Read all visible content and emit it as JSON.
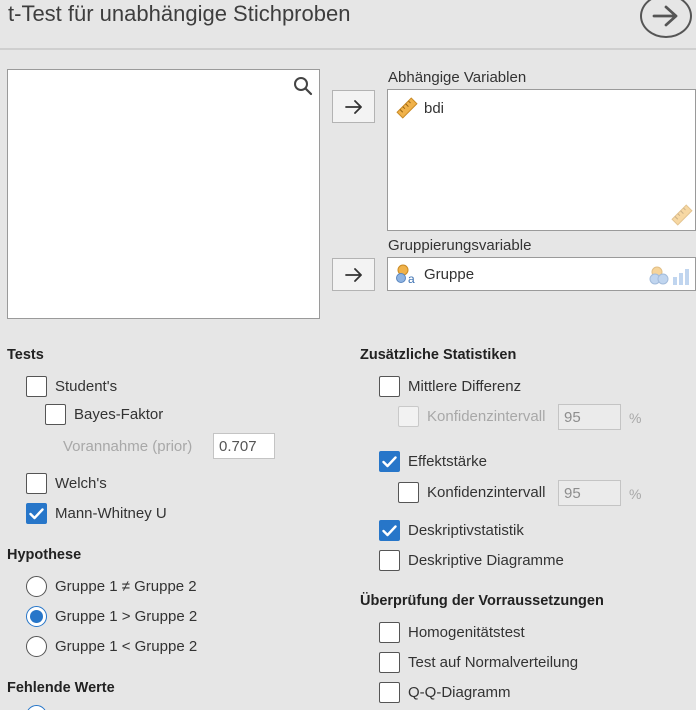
{
  "header": {
    "title": "t-Test für unabhängige Stichproben"
  },
  "variables": {
    "search_icon": "search-icon"
  },
  "dependent": {
    "label": "Abhängige Variablen",
    "items": [
      {
        "name": "bdi",
        "icon": "ruler-icon"
      }
    ]
  },
  "grouping": {
    "label": "Gruppierungsvariable",
    "item": {
      "name": "Gruppe",
      "icon": "nominal-text-icon"
    }
  },
  "tests": {
    "heading": "Tests",
    "student": {
      "label": "Student's",
      "checked": false
    },
    "bayes": {
      "label": "Bayes-Faktor",
      "checked": false
    },
    "prior": {
      "label": "Vorannahme (prior)",
      "value": "0.707"
    },
    "welch": {
      "label": "Welch's",
      "checked": false
    },
    "mann_whitney": {
      "label": "Mann-Whitney U",
      "checked": true
    }
  },
  "hypothesis": {
    "heading": "Hypothese",
    "options": [
      {
        "label": "Gruppe 1 ≠ Gruppe 2",
        "selected": false
      },
      {
        "label": "Gruppe 1 > Gruppe 2",
        "selected": true
      },
      {
        "label": "Gruppe 1 < Gruppe 2",
        "selected": false
      }
    ]
  },
  "missing": {
    "heading": "Fehlende Werte"
  },
  "additional": {
    "heading": "Zusätzliche Statistiken",
    "mean_diff": {
      "label": "Mittlere Differenz",
      "checked": false
    },
    "mean_diff_ci": {
      "label": "Konfidenzintervall",
      "value": "95",
      "unit": "%",
      "checked": false,
      "enabled": false
    },
    "effect_size": {
      "label": "Effektstärke",
      "checked": true
    },
    "effect_size_ci": {
      "label": "Konfidenzintervall",
      "value": "95",
      "unit": "%",
      "checked": false,
      "enabled": true
    },
    "descriptives": {
      "label": "Deskriptivstatistik",
      "checked": true
    },
    "desc_plots": {
      "label": "Deskriptive Diagramme",
      "checked": false
    }
  },
  "assumptions": {
    "heading": "Überprüfung der Vorraussetzungen",
    "homogeneity": {
      "label": "Homogenitätstest",
      "checked": false
    },
    "normality": {
      "label": "Test auf Normalverteilung",
      "checked": false
    },
    "qq": {
      "label": "Q-Q-Diagramm",
      "checked": false
    }
  },
  "colors": {
    "accent": "#2776c9",
    "background": "#e6e6e6",
    "scale_icon": "#e8a33a",
    "nominal_icon": "#7ea7d8"
  }
}
